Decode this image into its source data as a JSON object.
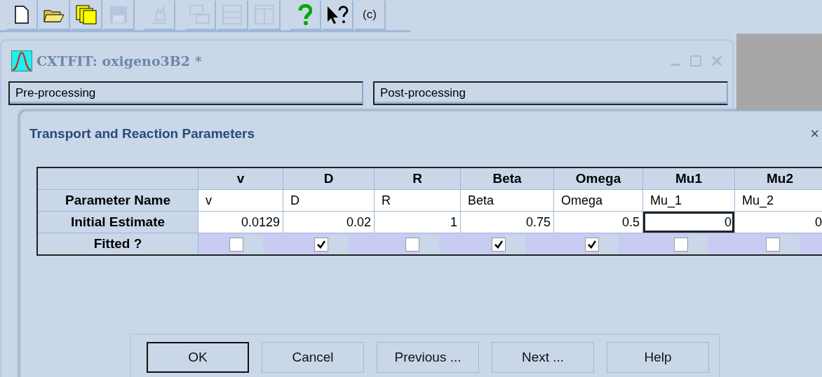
{
  "toolbar": [
    {
      "kind": "new",
      "disabled": false
    },
    {
      "kind": "open",
      "disabled": false
    },
    {
      "kind": "copy",
      "disabled": false
    },
    {
      "kind": "save",
      "disabled": true
    },
    {
      "kind": "wizard",
      "disabled": true
    },
    {
      "kind": "cascade",
      "disabled": true
    },
    {
      "kind": "tile-h",
      "disabled": true
    },
    {
      "kind": "tile-v",
      "disabled": true
    },
    {
      "kind": "help",
      "disabled": false
    },
    {
      "kind": "whats-this",
      "disabled": false
    },
    {
      "kind": "text",
      "label": "(c)",
      "disabled": false
    }
  ],
  "window": {
    "title": "CXTFIT: oxigeno3B2 *",
    "active": false
  },
  "panels": [
    {
      "label": "Pre-processing"
    },
    {
      "label": "Post-processing"
    }
  ],
  "dialog": {
    "title": "Transport and Reaction Parameters",
    "close": "×",
    "table": {
      "columns": [
        "v",
        "D",
        "R",
        "Beta",
        "Omega",
        "Mu1",
        "Mu2"
      ],
      "rows": [
        {
          "label": "Parameter Name",
          "kind": "name",
          "cells": [
            {
              "text": "v"
            },
            {
              "text": "D"
            },
            {
              "text": "R"
            },
            {
              "text": "Beta"
            },
            {
              "text": "Omega"
            },
            {
              "text": "Mu_1"
            },
            {
              "text": "Mu_2"
            }
          ]
        },
        {
          "label": "Initial Estimate",
          "kind": "number",
          "cells": [
            {
              "text": "0.0129",
              "selected": false
            },
            {
              "text": "0.02",
              "selected": false
            },
            {
              "text": "1",
              "selected": false
            },
            {
              "text": "0.75",
              "selected": false
            },
            {
              "text": "0.5",
              "selected": false
            },
            {
              "text": "0",
              "selected": true
            },
            {
              "text": "0",
              "selected": false
            }
          ]
        },
        {
          "label": "Fitted ?",
          "kind": "check",
          "cells": [
            {
              "checked": false
            },
            {
              "checked": true
            },
            {
              "checked": false
            },
            {
              "checked": true
            },
            {
              "checked": true
            },
            {
              "checked": false
            },
            {
              "checked": false
            }
          ]
        }
      ]
    },
    "buttons": [
      {
        "label": "OK",
        "default": true
      },
      {
        "label": "Cancel",
        "default": false
      },
      {
        "label": "Previous ...",
        "default": false
      },
      {
        "label": "Next ...",
        "default": false
      },
      {
        "label": "Help",
        "default": false
      }
    ]
  }
}
